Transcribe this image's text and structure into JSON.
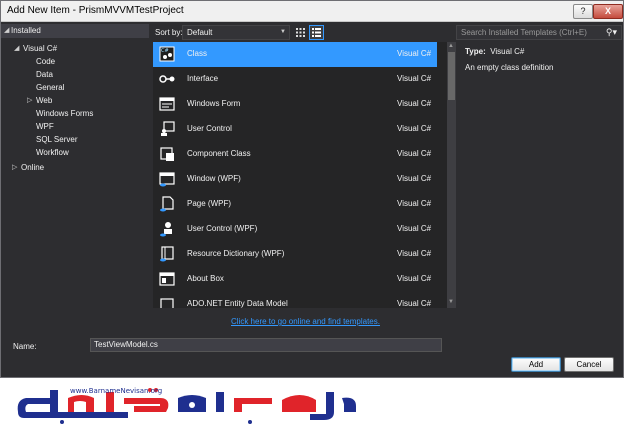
{
  "window": {
    "title": "Add New Item - PrismMVVMTestProject",
    "help_label": "?",
    "close_label": "X"
  },
  "tree": {
    "installed_label": "Installed",
    "visual_csharp_label": "Visual C#",
    "children": [
      "Code",
      "Data",
      "General",
      "Web",
      "Windows Forms",
      "WPF",
      "SQL Server",
      "Workflow"
    ],
    "online_label": "Online"
  },
  "toolbar": {
    "sort_label": "Sort by:",
    "sort_value": "Default"
  },
  "search": {
    "placeholder": "Search Installed Templates (Ctrl+E)"
  },
  "templates": [
    {
      "name": "Class",
      "lang": "Visual C#",
      "icon": "class-icon"
    },
    {
      "name": "Interface",
      "lang": "Visual C#",
      "icon": "interface-icon"
    },
    {
      "name": "Windows Form",
      "lang": "Visual C#",
      "icon": "windows-form-icon"
    },
    {
      "name": "User Control",
      "lang": "Visual C#",
      "icon": "user-control-icon"
    },
    {
      "name": "Component Class",
      "lang": "Visual C#",
      "icon": "component-class-icon"
    },
    {
      "name": "Window (WPF)",
      "lang": "Visual C#",
      "icon": "wpf-window-icon"
    },
    {
      "name": "Page (WPF)",
      "lang": "Visual C#",
      "icon": "wpf-page-icon"
    },
    {
      "name": "User Control (WPF)",
      "lang": "Visual C#",
      "icon": "wpf-user-control-icon"
    },
    {
      "name": "Resource Dictionary (WPF)",
      "lang": "Visual C#",
      "icon": "resource-dictionary-icon"
    },
    {
      "name": "About Box",
      "lang": "Visual C#",
      "icon": "about-box-icon"
    },
    {
      "name": "ADO.NET Entity Data Model",
      "lang": "Visual C#",
      "icon": "entity-model-icon"
    }
  ],
  "selected_template": "Class",
  "details": {
    "type_label": "Type:",
    "type_value": "Visual C#",
    "description": "An empty class definition"
  },
  "online_link": "Click here to go online and find templates.",
  "name_field": {
    "label": "Name:",
    "value": "TestViewModel.cs"
  },
  "buttons": {
    "add": "Add",
    "cancel": "Cancel"
  },
  "watermark": {
    "site": "www.BarnameNevisan.org"
  },
  "colors": {
    "accent": "#3399ff",
    "background": "#2d2d30",
    "list_background": "#252526"
  }
}
